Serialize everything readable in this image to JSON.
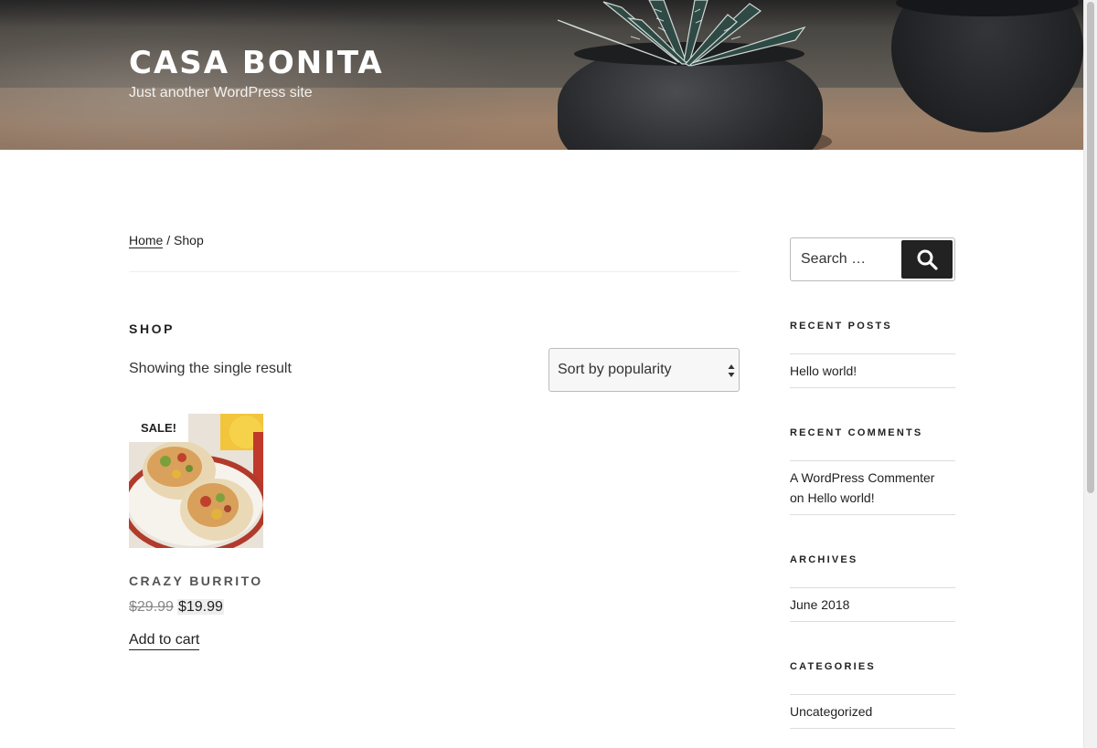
{
  "header": {
    "site_title": "CASA BONITA",
    "site_description": "Just another WordPress site"
  },
  "breadcrumb": {
    "home": "Home",
    "separator": " / ",
    "current": "Shop"
  },
  "shop": {
    "title": "SHOP",
    "result_count": "Showing the single result",
    "orderby_selected": "Sort by popularity"
  },
  "product": {
    "sale_badge": "SALE!",
    "name": "CRAZY BURRITO",
    "regular_price": "$29.99",
    "sale_price": "$19.99",
    "add_to_cart": "Add to cart"
  },
  "sidebar": {
    "search_placeholder": "Search …",
    "search_icon": "search-icon",
    "recent_posts": {
      "title": "RECENT POSTS",
      "items": [
        "Hello world!"
      ]
    },
    "recent_comments": {
      "title": "RECENT COMMENTS",
      "author": "A WordPress Commenter",
      "on_text": "on",
      "post": "Hello world!"
    },
    "archives": {
      "title": "ARCHIVES",
      "items": [
        "June 2018"
      ]
    },
    "categories": {
      "title": "CATEGORIES",
      "items": [
        "Uncategorized"
      ]
    }
  },
  "colors": {
    "text": "#222222",
    "search_button": "#222222",
    "price_highlight": "#eeeeee",
    "rule": "#dddddd"
  }
}
